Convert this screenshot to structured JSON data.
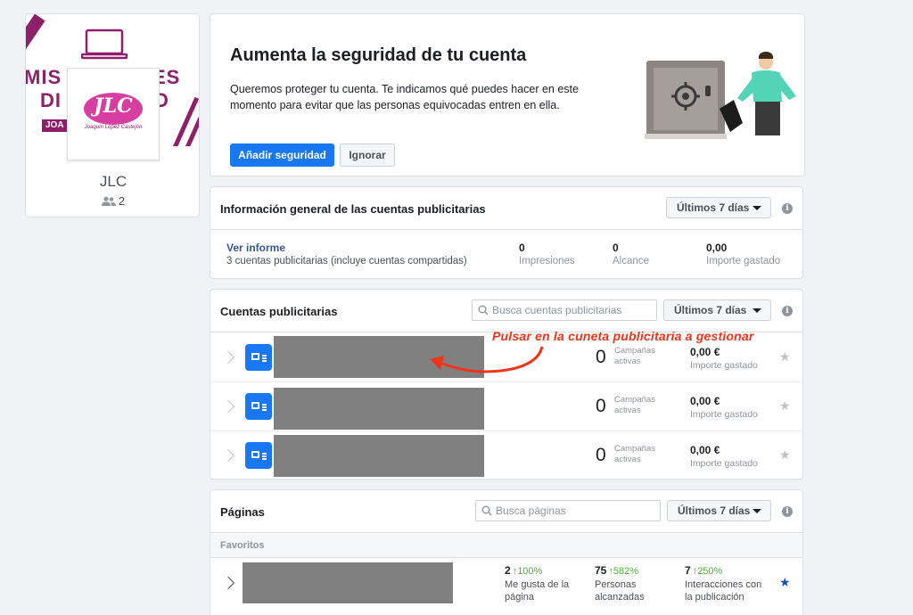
{
  "profile": {
    "cover_text": [
      "MIS",
      "DI",
      "ES",
      "D"
    ],
    "cover_banner": "JOA",
    "logo_letters": "JLC",
    "logo_subtext": "Joaquín López Castejón",
    "name": "JLC",
    "followers": "2"
  },
  "security": {
    "title": "Aumenta la seguridad de tu cuenta",
    "description": "Queremos proteger tu cuenta. Te indicamos qué puedes hacer en este momento para evitar que las personas equivocadas entren en ella.",
    "add_label": "Añadir seguridad",
    "ignore_label": "Ignorar"
  },
  "overview": {
    "title": "Información general de las cuentas publicitarias",
    "range": "Últimos 7 días",
    "link": "Ver informe",
    "subtitle": "3 cuentas publicitarias (incluye cuentas compartidas)",
    "metrics": [
      {
        "value": "0",
        "label": "Impresiones"
      },
      {
        "value": "0",
        "label": "Alcance"
      },
      {
        "value": "0,00",
        "label": "Importe gastado"
      }
    ]
  },
  "accounts": {
    "title": "Cuentas publicitarias",
    "search_placeholder": "Busca cuentas publicitarias",
    "range": "Últimos 7 días",
    "annotation": "Pulsar en la cuneta publicitaria a gestionar",
    "rows": [
      {
        "campaigns": "0",
        "campaigns_label_1": "Campañas",
        "campaigns_label_2": "activas",
        "amount": "0,00 €",
        "amount_label": "Importe gastado"
      },
      {
        "campaigns": "0",
        "campaigns_label_1": "Campañas",
        "campaigns_label_2": "activas",
        "amount": "0,00 €",
        "amount_label": "Importe gastado"
      },
      {
        "campaigns": "0",
        "campaigns_label_1": "Campañas",
        "campaigns_label_2": "activas",
        "amount": "0,00 €",
        "amount_label": "Importe gastado"
      }
    ]
  },
  "pages": {
    "title": "Páginas",
    "search_placeholder": "Busca páginas",
    "range": "Últimos 7 días",
    "favorites_label": "Favoritos",
    "row": {
      "metrics": [
        {
          "value": "2",
          "change": "↑100%",
          "label_1": "Me gusta de la",
          "label_2": "página"
        },
        {
          "value": "75",
          "change": "↑582%",
          "label_1": "Personas",
          "label_2": "alcanzadas"
        },
        {
          "value": "7",
          "change": "↑250%",
          "label_1": "Interacciones con",
          "label_2": "la publicación"
        }
      ]
    }
  },
  "colors": {
    "accent": "#1877f2",
    "brand_magenta": "#8e1f6a",
    "annotation_red": "#f0341a",
    "growth_green": "#42b72a"
  }
}
